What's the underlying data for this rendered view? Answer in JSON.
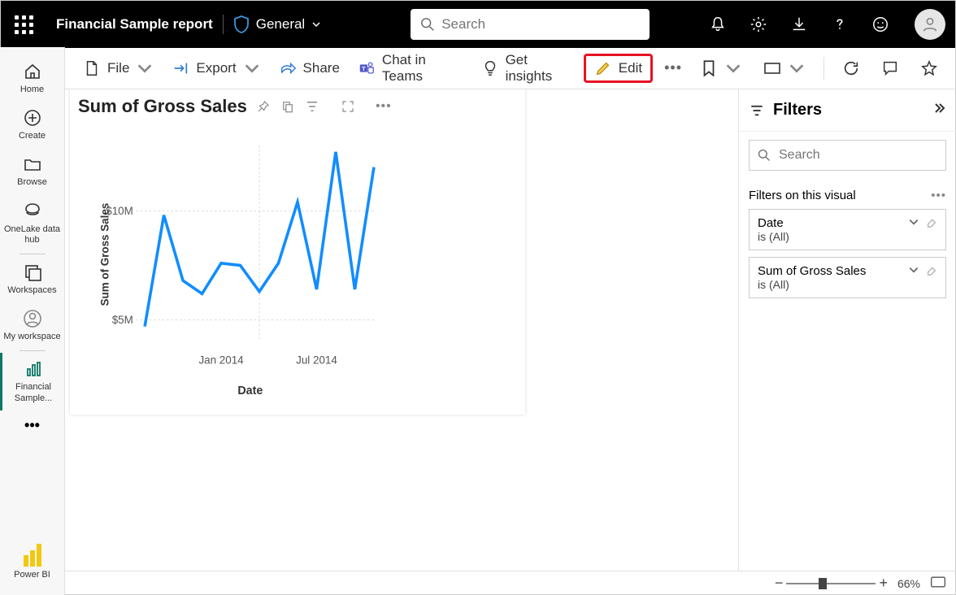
{
  "header": {
    "report_title": "Financial Sample report",
    "sensitivity_label": "General",
    "search_placeholder": "Search"
  },
  "left_nav": {
    "home": "Home",
    "create": "Create",
    "browse": "Browse",
    "onelake": "OneLake data hub",
    "workspaces": "Workspaces",
    "my_workspace": "My workspace",
    "financial": "Financial Sample...",
    "powerbi": "Power BI"
  },
  "toolbar": {
    "file": "File",
    "export": "Export",
    "share": "Share",
    "chat_teams": "Chat in Teams",
    "insights": "Get insights",
    "edit": "Edit"
  },
  "visual": {
    "title": "Sum of Gross Sales"
  },
  "chart_data": {
    "type": "line",
    "xlabel": "Date",
    "ylabel": "Sum of Gross Sales",
    "yticks": [
      {
        "value": 5000000,
        "label": "$5M"
      },
      {
        "value": 10000000,
        "label": "$10M"
      }
    ],
    "xticks": [
      "Jan 2014",
      "Jul 2014"
    ],
    "points": [
      {
        "x": 0,
        "y": 4700000
      },
      {
        "x": 1,
        "y": 9800000
      },
      {
        "x": 2,
        "y": 6800000
      },
      {
        "x": 3,
        "y": 6200000
      },
      {
        "x": 4,
        "y": 7600000
      },
      {
        "x": 5,
        "y": 7500000
      },
      {
        "x": 6,
        "y": 6300000
      },
      {
        "x": 7,
        "y": 7600000
      },
      {
        "x": 8,
        "y": 10400000
      },
      {
        "x": 9,
        "y": 6400000
      },
      {
        "x": 10,
        "y": 12700000
      },
      {
        "x": 11,
        "y": 6400000
      },
      {
        "x": 12,
        "y": 12000000
      }
    ]
  },
  "filters": {
    "pane_title": "Filters",
    "search_placeholder": "Search",
    "section_title": "Filters on this visual",
    "items": [
      {
        "name": "Date",
        "value": "is (All)"
      },
      {
        "name": "Sum of Gross Sales",
        "value": "is (All)"
      }
    ]
  },
  "status": {
    "zoom": "66%"
  }
}
